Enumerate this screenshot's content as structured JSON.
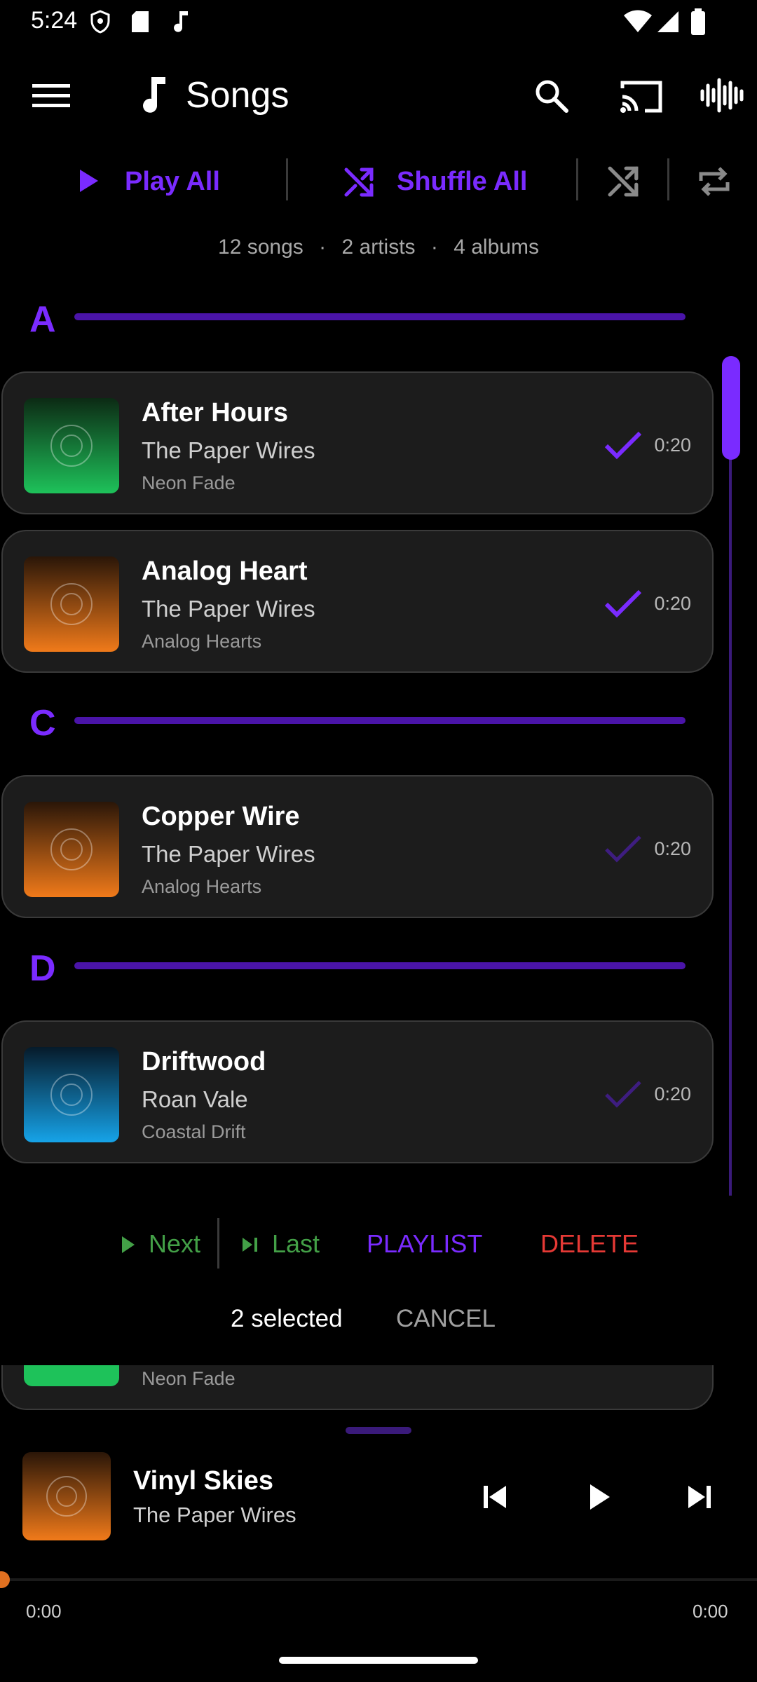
{
  "status_bar": {
    "time": "5:24"
  },
  "app_bar": {
    "title": "Songs"
  },
  "controls": {
    "play_all": "Play All",
    "shuffle_all": "Shuffle All"
  },
  "stats": {
    "songs": "12 songs",
    "sep": "·",
    "artists": "2 artists",
    "albums": "4 albums"
  },
  "sections": [
    {
      "letter": "A"
    },
    {
      "letter": "C"
    },
    {
      "letter": "D"
    }
  ],
  "songs": [
    {
      "title": "After Hours",
      "artist": "The Paper Wires",
      "album": "Neon Fade",
      "duration": "0:20",
      "selected": true,
      "art_color": "#1ec25a"
    },
    {
      "title": "Analog Heart",
      "artist": "The Paper Wires",
      "album": "Analog Hearts",
      "duration": "0:20",
      "selected": true,
      "art_color": "#f07a1a"
    },
    {
      "title": "Copper Wire",
      "artist": "The Paper Wires",
      "album": "Analog Hearts",
      "duration": "0:20",
      "selected": false,
      "art_color": "#f07a1a"
    },
    {
      "title": "Driftwood",
      "artist": "Roan Vale",
      "album": "Coastal Drift",
      "duration": "0:20",
      "selected": false,
      "art_color": "#16a3e8"
    },
    {
      "title": "",
      "artist": "",
      "album": "Neon Fade",
      "duration": "",
      "selected": false,
      "art_color": "#1ec25a"
    }
  ],
  "selection_bar": {
    "next": "Next",
    "last": "Last",
    "playlist": "PLAYLIST",
    "delete": "DELETE",
    "selected_count": "2 selected",
    "cancel": "CANCEL"
  },
  "mini_player": {
    "title": "Vinyl Skies",
    "artist": "The Paper Wires",
    "elapsed": "0:00",
    "total": "0:00",
    "progress": 0
  },
  "colors": {
    "accent": "#7a2bff",
    "delete": "#e53935",
    "next_green": "#43a047"
  }
}
